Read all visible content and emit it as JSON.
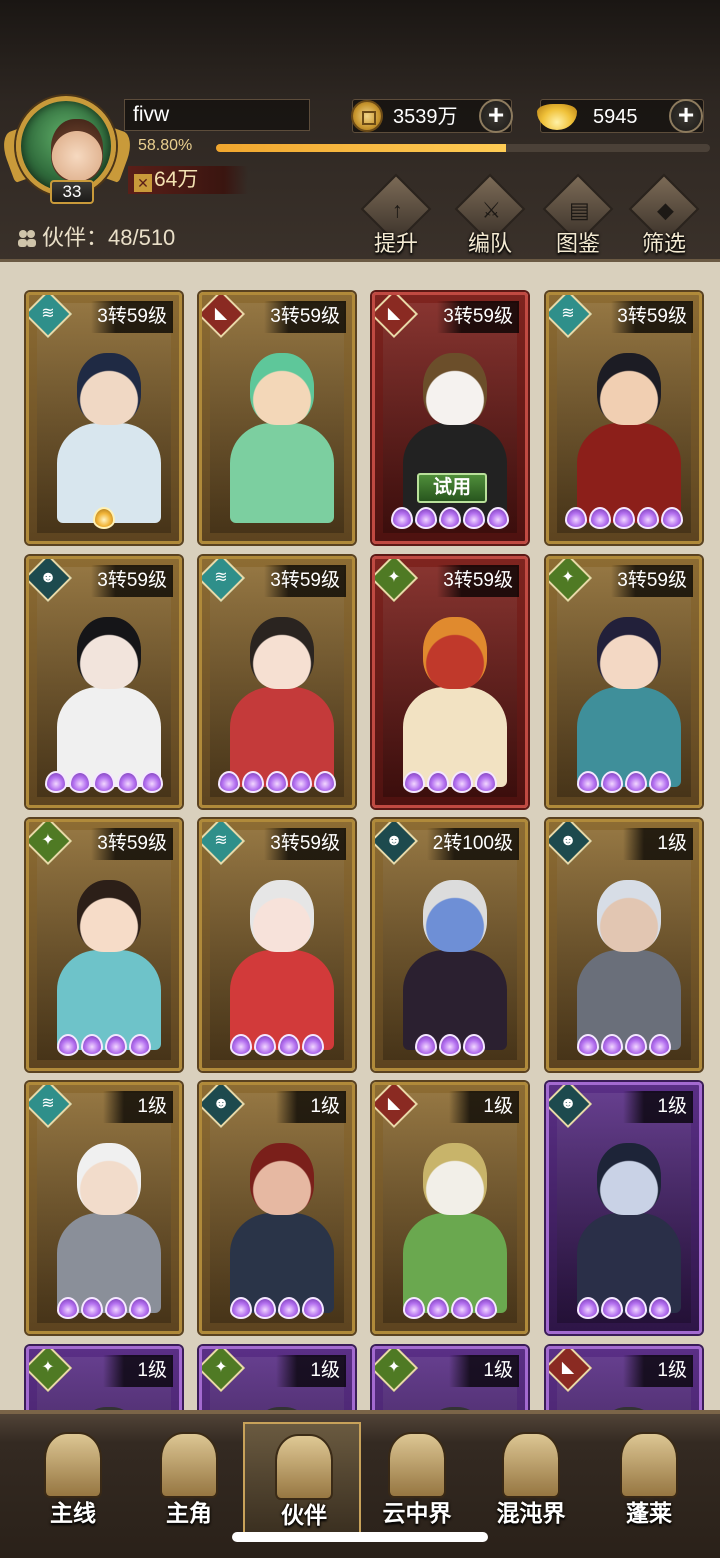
{
  "player": {
    "name": "fivw",
    "level": "33",
    "exp_text": "58.80%",
    "exp_fraction": 0.588,
    "power": "64万"
  },
  "currency": {
    "coins": "3539万",
    "ingots": "5945",
    "add_symbol": "+"
  },
  "partners_label": "伙伴：48/510",
  "top_actions": [
    {
      "label": "提升",
      "glyph": "↑"
    },
    {
      "label": "编队",
      "glyph": "⚔"
    },
    {
      "label": "图鉴",
      "glyph": "▤"
    },
    {
      "label": "筛选",
      "glyph": "◆"
    }
  ],
  "cards": [
    {
      "level": "3转59级",
      "frame": "gold",
      "element": "wind",
      "stars": 1,
      "star_type": "gold",
      "hair": "#1f2a44",
      "skin": "#f0d8c4",
      "outfit": "#d8e6ee",
      "trial": ""
    },
    {
      "level": "3转59级",
      "frame": "gold",
      "element": "fox",
      "stars": 0,
      "star_type": "purple",
      "hair": "#5ec79a",
      "skin": "#f3d7b8",
      "outfit": "#7ccfa0",
      "trial": ""
    },
    {
      "level": "3转59级",
      "frame": "red",
      "element": "fox",
      "stars": 5,
      "star_type": "purple",
      "hair": "#6b4e2a",
      "skin": "#f5f2ef",
      "outfit": "#222222",
      "trial": "试用"
    },
    {
      "level": "3转59级",
      "frame": "gold",
      "element": "wind",
      "stars": 5,
      "star_type": "purple",
      "hair": "#1c1c24",
      "skin": "#f1cfb2",
      "outfit": "#8c1f1a",
      "trial": ""
    },
    {
      "level": "3转59级",
      "frame": "gold",
      "element": "demon",
      "stars": 5,
      "star_type": "purple",
      "hair": "#151518",
      "skin": "#f2e4dc",
      "outfit": "#f0f0f0",
      "trial": ""
    },
    {
      "level": "3转59级",
      "frame": "gold",
      "element": "wind",
      "stars": 5,
      "star_type": "purple",
      "hair": "#2a2420",
      "skin": "#f6e0d2",
      "outfit": "#c43a3a",
      "trial": ""
    },
    {
      "level": "3转59级",
      "frame": "red",
      "element": "leaf",
      "stars": 4,
      "star_type": "purple",
      "hair": "#e08a2e",
      "skin": "#c0392b",
      "outfit": "#f2e2c2",
      "trial": ""
    },
    {
      "level": "3转59级",
      "frame": "gold",
      "element": "leaf",
      "stars": 4,
      "star_type": "purple",
      "hair": "#22203a",
      "skin": "#f3d8c4",
      "outfit": "#3f8f9a",
      "trial": ""
    },
    {
      "level": "3转59级",
      "frame": "gold",
      "element": "leaf",
      "stars": 4,
      "star_type": "purple",
      "hair": "#2c1f18",
      "skin": "#f6dcc8",
      "outfit": "#6ec3c9",
      "trial": ""
    },
    {
      "level": "3转59级",
      "frame": "gold",
      "element": "wind",
      "stars": 4,
      "star_type": "purple",
      "hair": "#e6e6e6",
      "skin": "#f7e2da",
      "outfit": "#d23a3a",
      "trial": ""
    },
    {
      "level": "2转100级",
      "frame": "gold",
      "element": "demon",
      "stars": 3,
      "star_type": "purple",
      "hair": "#dcdcdc",
      "skin": "#6e8fd6",
      "outfit": "#2b2030",
      "trial": ""
    },
    {
      "level": "1级",
      "frame": "gold",
      "element": "demon",
      "stars": 4,
      "star_type": "purple",
      "hair": "#d7dde6",
      "skin": "#e2c6b2",
      "outfit": "#6a6f7a",
      "trial": ""
    },
    {
      "level": "1级",
      "frame": "gold",
      "element": "wind",
      "stars": 4,
      "star_type": "purple",
      "hair": "#f0f0f0",
      "skin": "#f2dccb",
      "outfit": "#8a8f99",
      "trial": ""
    },
    {
      "level": "1级",
      "frame": "gold",
      "element": "demon",
      "stars": 4,
      "star_type": "purple",
      "hair": "#7a1f1a",
      "skin": "#e6b8a2",
      "outfit": "#2a3448",
      "trial": ""
    },
    {
      "level": "1级",
      "frame": "gold",
      "element": "fox",
      "stars": 4,
      "star_type": "purple",
      "hair": "#c8b46a",
      "skin": "#f2efe8",
      "outfit": "#6aa84f",
      "trial": ""
    },
    {
      "level": "1级",
      "frame": "purple",
      "element": "demon",
      "stars": 4,
      "star_type": "purple",
      "hair": "#1d2438",
      "skin": "#c9d2e6",
      "outfit": "#2a2f48",
      "trial": ""
    },
    {
      "level": "1级",
      "frame": "purple",
      "element": "leaf",
      "stars": 0,
      "star_type": "purple",
      "hair": "#333333",
      "skin": "#e0c8b8",
      "outfit": "#5a3d7a",
      "trial": ""
    },
    {
      "level": "1级",
      "frame": "purple",
      "element": "leaf",
      "stars": 0,
      "star_type": "purple",
      "hair": "#333333",
      "skin": "#e0c8b8",
      "outfit": "#5a3d7a",
      "trial": ""
    },
    {
      "level": "1级",
      "frame": "purple",
      "element": "leaf",
      "stars": 0,
      "star_type": "purple",
      "hair": "#333333",
      "skin": "#e0c8b8",
      "outfit": "#5a3d7a",
      "trial": ""
    },
    {
      "level": "1级",
      "frame": "purple",
      "element": "fox",
      "stars": 0,
      "star_type": "purple",
      "hair": "#333333",
      "skin": "#e0c8b8",
      "outfit": "#5a3d7a",
      "trial": ""
    }
  ],
  "element_colors": {
    "wind": "#2f8f8a",
    "fox": "#8a2a22",
    "demon": "#1d4a4e",
    "leaf": "#4f7a24"
  },
  "element_glyphs": {
    "wind": "≋",
    "fox": "◣",
    "demon": "☻",
    "leaf": "✦"
  },
  "nav": [
    {
      "label": "主线",
      "active": false
    },
    {
      "label": "主角",
      "active": false
    },
    {
      "label": "伙伴",
      "active": true
    },
    {
      "label": "云中界",
      "active": false
    },
    {
      "label": "混沌界",
      "active": false
    },
    {
      "label": "蓬莱",
      "active": false
    }
  ]
}
